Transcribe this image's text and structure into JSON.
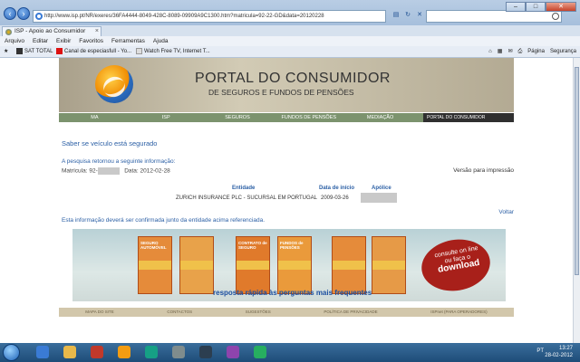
{
  "browser": {
    "url": "http://www.isp.pt/NR/exeres/36FA4444-8049-428C-8089-09909A9C1300.htm?matricula=92-22-GD&data=20120228",
    "tab_title": "ISP - Apoio ao Consumidor",
    "menu": [
      "Arquivo",
      "Editar",
      "Exibir",
      "Favoritos",
      "Ferramentas",
      "Ajuda"
    ],
    "favorites": [
      "SAT TOTAL",
      "Canal de especiasfull - Yo...",
      "Watch Free TV, Internet T..."
    ],
    "commands": [
      "Página",
      "Segurança"
    ]
  },
  "page": {
    "banner_title": "PORTAL DO CONSUMIDOR",
    "banner_subtitle": "DE SEGUROS E FUNDOS DE PENSÕES",
    "nav": [
      "MA",
      "ISP",
      "SEGUROS",
      "FUNDOS DE PENSÕES",
      "MEDIAÇÃO"
    ],
    "nav_brand": "PORTAL DO CONSUMIDOR",
    "heading": "Saber se veículo está segurado",
    "result_note": "A pesquisa retornou a seguinte informação:",
    "matricula_label": "Matrícula:",
    "matricula_value": "92-",
    "data_label": "Data:",
    "data_value": "2012-02-28",
    "print_link": "Versão para impressão",
    "table": {
      "headers": [
        "Entidade",
        "Data de início",
        "Apólice"
      ],
      "row": [
        "ZURICH INSURANCE PLC - SUCURSAL EM PORTUGAL",
        "2009-03-26",
        ""
      ]
    },
    "voltar": "Voltar",
    "info": "Esta informação deverá ser confirmada junto da entidade acima referenciada.",
    "promo": {
      "books": [
        "SEGURO AUTOMÓVEL",
        "",
        "CONTRATO de SEGURO",
        "FUNDOS de PENSÕES",
        "",
        ""
      ],
      "stamp_line1": "consulte on line",
      "stamp_line2": "ou faça o",
      "stamp_line3": "download",
      "caption": "resposta rápida às perguntas mais frequentes"
    },
    "footer": [
      "MAPA DO SITE",
      "CONTACTOS",
      "SUGESTÕES",
      "POLÍTICA DE PRIVACIDADE",
      "ISPnet (PARA OPERADORES)"
    ]
  },
  "taskbar": {
    "tray_lang": "PT",
    "time": "13:27",
    "date": "28-02-2012"
  }
}
